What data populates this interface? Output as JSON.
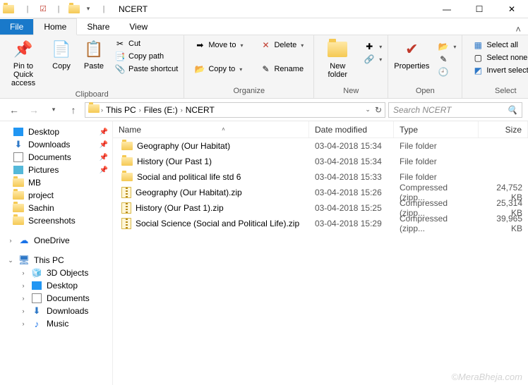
{
  "window": {
    "title": "NCERT"
  },
  "tabs": {
    "file": "File",
    "home": "Home",
    "share": "Share",
    "view": "View"
  },
  "ribbon": {
    "clipboard": {
      "label": "Clipboard",
      "pin": "Pin to Quick access",
      "copy": "Copy",
      "paste": "Paste",
      "cut": "Cut",
      "copypath": "Copy path",
      "shortcut": "Paste shortcut"
    },
    "organize": {
      "label": "Organize",
      "moveto": "Move to",
      "copyto": "Copy to",
      "delete": "Delete",
      "rename": "Rename"
    },
    "new": {
      "label": "New",
      "newfolder": "New folder"
    },
    "open": {
      "label": "Open",
      "properties": "Properties"
    },
    "select": {
      "label": "Select",
      "all": "Select all",
      "none": "Select none",
      "invert": "Invert selection"
    }
  },
  "breadcrumbs": [
    "This PC",
    "Files (E:)",
    "NCERT"
  ],
  "search": {
    "placeholder": "Search NCERT"
  },
  "sidebar": {
    "quick": [
      {
        "label": "Desktop",
        "pinned": true,
        "icon": "desktop"
      },
      {
        "label": "Downloads",
        "pinned": true,
        "icon": "downloads"
      },
      {
        "label": "Documents",
        "pinned": true,
        "icon": "documents"
      },
      {
        "label": "Pictures",
        "pinned": true,
        "icon": "pictures"
      },
      {
        "label": "MB",
        "pinned": false,
        "icon": "folder"
      },
      {
        "label": "project",
        "pinned": false,
        "icon": "folder"
      },
      {
        "label": "Sachin",
        "pinned": false,
        "icon": "folder"
      },
      {
        "label": "Screenshots",
        "pinned": false,
        "icon": "folder"
      }
    ],
    "onedrive": "OneDrive",
    "thispc": {
      "label": "This PC",
      "items": [
        {
          "label": "3D Objects",
          "icon": "3d"
        },
        {
          "label": "Desktop",
          "icon": "desktop"
        },
        {
          "label": "Documents",
          "icon": "documents"
        },
        {
          "label": "Downloads",
          "icon": "downloads"
        },
        {
          "label": "Music",
          "icon": "music"
        }
      ]
    }
  },
  "columns": {
    "name": "Name",
    "date": "Date modified",
    "type": "Type",
    "size": "Size"
  },
  "files": [
    {
      "name": "Geography (Our Habitat)",
      "date": "03-04-2018 15:34",
      "type": "File folder",
      "size": "",
      "kind": "folder"
    },
    {
      "name": "History (Our Past 1)",
      "date": "03-04-2018 15:34",
      "type": "File folder",
      "size": "",
      "kind": "folder"
    },
    {
      "name": "Social and political life std 6",
      "date": "03-04-2018 15:33",
      "type": "File folder",
      "size": "",
      "kind": "folder"
    },
    {
      "name": "Geography (Our Habitat).zip",
      "date": "03-04-2018 15:26",
      "type": "Compressed (zipp...",
      "size": "24,752 KB",
      "kind": "zip"
    },
    {
      "name": "History (Our Past 1).zip",
      "date": "03-04-2018 15:25",
      "type": "Compressed (zipp...",
      "size": "25,314 KB",
      "kind": "zip"
    },
    {
      "name": "Social Science (Social and Political Life).zip",
      "date": "03-04-2018 15:29",
      "type": "Compressed (zipp...",
      "size": "39,965 KB",
      "kind": "zip"
    }
  ],
  "watermark": "©MeraBheja.com"
}
